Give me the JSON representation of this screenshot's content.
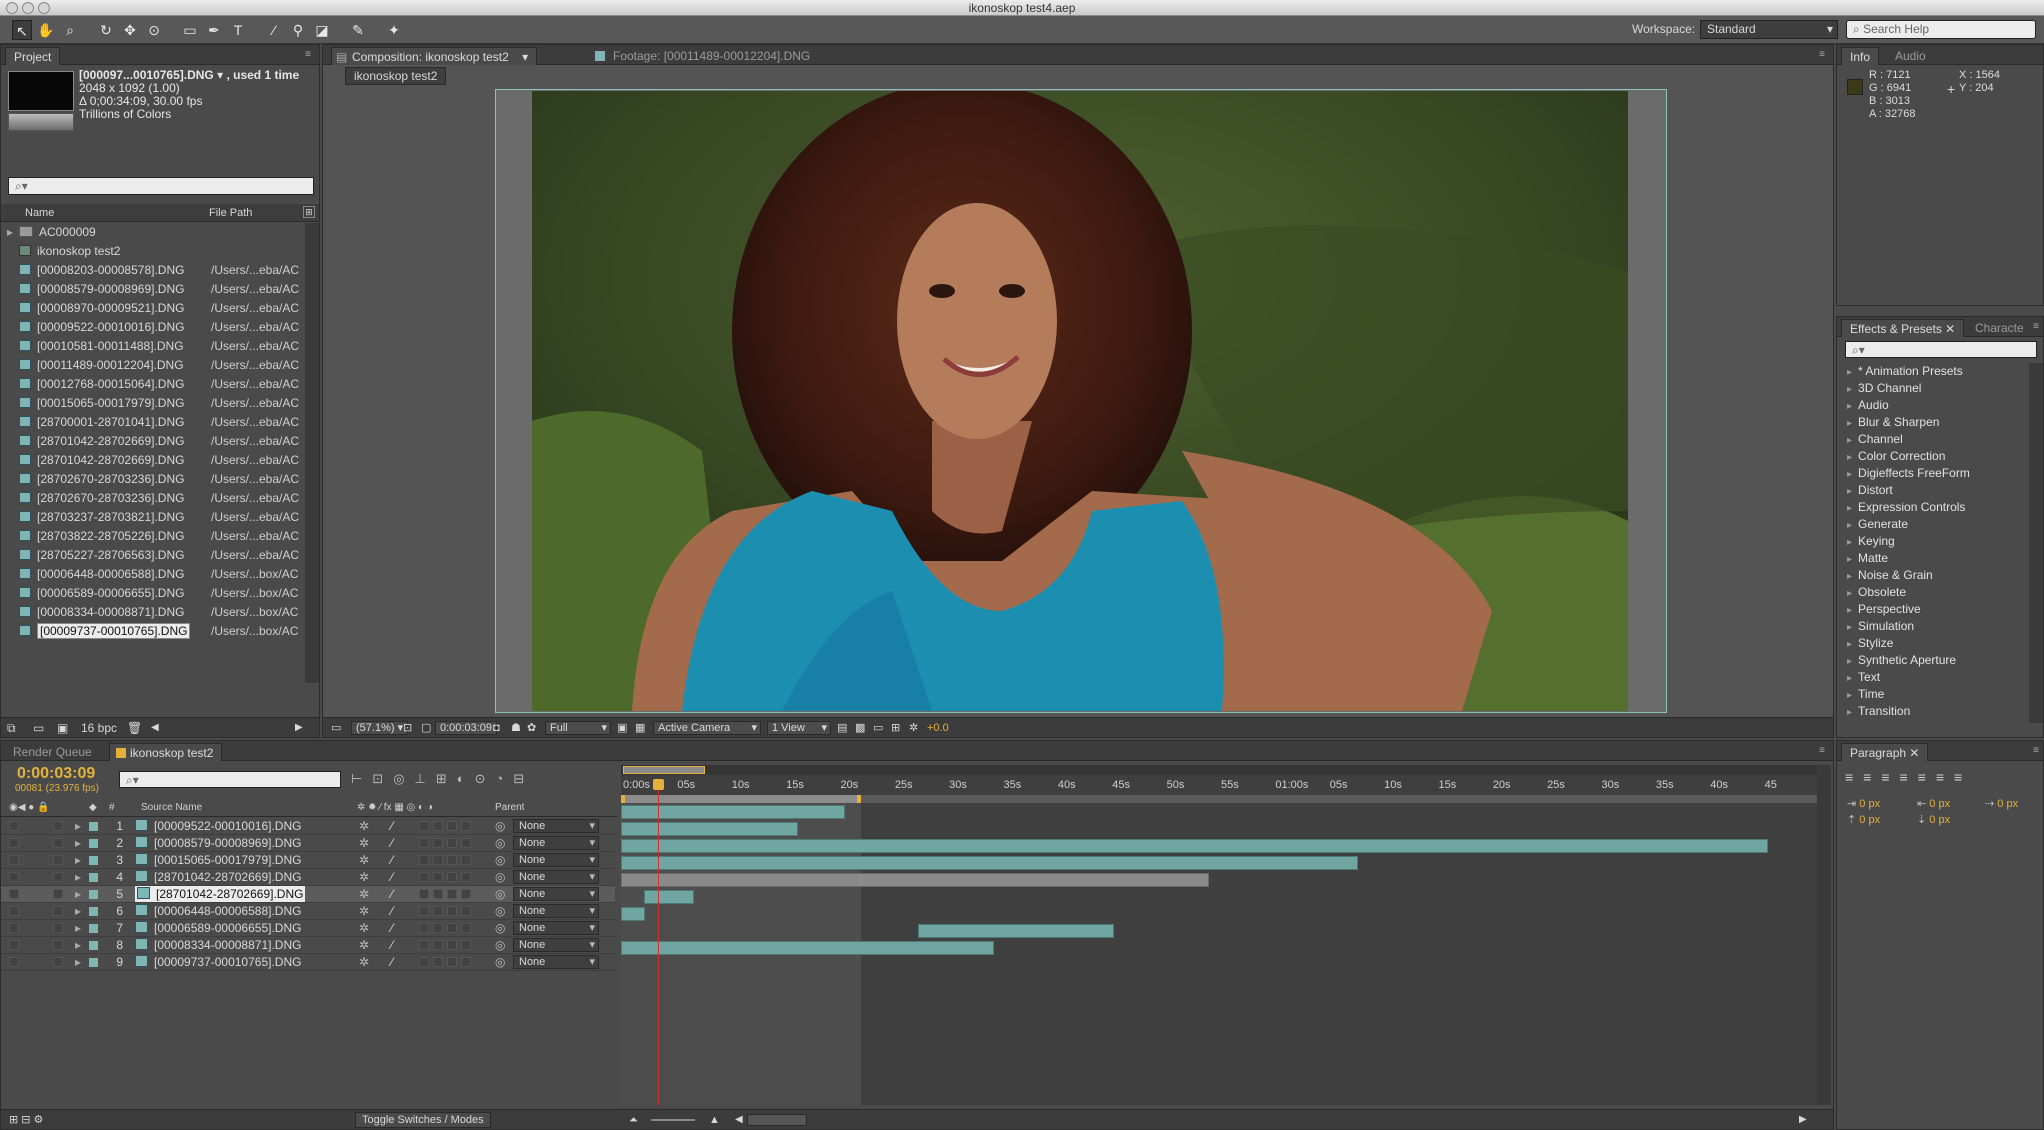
{
  "window": {
    "title": "ikonoskop test4.aep"
  },
  "toolbar": {
    "workspace_label": "Workspace:",
    "workspace_value": "Standard",
    "search_placeholder": "Search Help",
    "tools": [
      "selection-tool-icon",
      "hand-tool-icon",
      "zoom-tool-icon",
      "rotation-tool-icon",
      "camera-orbit-icon",
      "pan-behind-icon",
      "rectangle-tool-icon",
      "pen-tool-icon",
      "text-tool-icon",
      "brush-tool-icon",
      "clone-stamp-icon",
      "eraser-icon",
      "roto-brush-icon",
      "puppet-pin-icon"
    ]
  },
  "project": {
    "tab": "Project",
    "selected_name": "[000097...0010765].DNG ▾ , used 1 time",
    "selected_size": "2048 x 1092 (1.00)",
    "selected_duration": "Δ 0;00:34:09, 30.00 fps",
    "selected_colors": "Trillions of Colors",
    "col_name": "Name",
    "col_path": "File Path",
    "bpc": "16 bpc",
    "items": [
      {
        "name": "AC000009",
        "path": "",
        "kind": "folder"
      },
      {
        "name": "ikonoskop test2",
        "path": "",
        "kind": "comp"
      },
      {
        "name": "[00008203-00008578].DNG",
        "path": "/Users/...eba/AC",
        "kind": "file"
      },
      {
        "name": "[00008579-00008969].DNG",
        "path": "/Users/...eba/AC",
        "kind": "file"
      },
      {
        "name": "[00008970-00009521].DNG",
        "path": "/Users/...eba/AC",
        "kind": "file"
      },
      {
        "name": "[00009522-00010016].DNG",
        "path": "/Users/...eba/AC",
        "kind": "file"
      },
      {
        "name": "[00010581-00011488].DNG",
        "path": "/Users/...eba/AC",
        "kind": "file"
      },
      {
        "name": "[00011489-00012204].DNG",
        "path": "/Users/...eba/AC",
        "kind": "file"
      },
      {
        "name": "[00012768-00015064].DNG",
        "path": "/Users/...eba/AC",
        "kind": "file"
      },
      {
        "name": "[00015065-00017979].DNG",
        "path": "/Users/...eba/AC",
        "kind": "file"
      },
      {
        "name": "[28700001-28701041].DNG",
        "path": "/Users/...eba/AC",
        "kind": "file"
      },
      {
        "name": "[28701042-28702669].DNG",
        "path": "/Users/...eba/AC",
        "kind": "file"
      },
      {
        "name": "[28701042-28702669].DNG",
        "path": "/Users/...eba/AC",
        "kind": "file"
      },
      {
        "name": "[28702670-28703236].DNG",
        "path": "/Users/...eba/AC",
        "kind": "file"
      },
      {
        "name": "[28702670-28703236].DNG",
        "path": "/Users/...eba/AC",
        "kind": "file"
      },
      {
        "name": "[28703237-28703821].DNG",
        "path": "/Users/...eba/AC",
        "kind": "file"
      },
      {
        "name": "[28703822-28705226].DNG",
        "path": "/Users/...eba/AC",
        "kind": "file"
      },
      {
        "name": "[28705227-28706563].DNG",
        "path": "/Users/...eba/AC",
        "kind": "file"
      },
      {
        "name": "[00006448-00006588].DNG",
        "path": "/Users/...box/AC",
        "kind": "file"
      },
      {
        "name": "[00006589-00006655].DNG",
        "path": "/Users/...box/AC",
        "kind": "file"
      },
      {
        "name": "[00008334-00008871].DNG",
        "path": "/Users/...box/AC",
        "kind": "file"
      },
      {
        "name": "[00009737-00010765].DNG",
        "path": "/Users/...box/AC",
        "kind": "file",
        "selected": true
      }
    ]
  },
  "viewer": {
    "comp_tab": "Composition: ikonoskop test2",
    "footage_tab": "Footage: [00011489-00012204].DNG",
    "breadcrumb": "ikonoskop test2",
    "zoom": "(57.1%)",
    "timecode": "0:00:03:09",
    "resolution": "Full",
    "camera": "Active Camera",
    "view": "1 View",
    "exposure": "+0.0"
  },
  "info": {
    "tab": "Info",
    "audio_tab": "Audio",
    "r": "R : 7121",
    "g": "G : 6941",
    "b": "B : 3013",
    "a": "A : 32768",
    "x": "X : 1564",
    "y": "Y : 204",
    "swatch": "#3a3a18"
  },
  "effects": {
    "tab": "Effects & Presets",
    "char_tab": "Characte",
    "items": [
      "* Animation Presets",
      "3D Channel",
      "Audio",
      "Blur & Sharpen",
      "Channel",
      "Color Correction",
      "Digieffects FreeForm",
      "Distort",
      "Expression Controls",
      "Generate",
      "Keying",
      "Matte",
      "Noise & Grain",
      "Obsolete",
      "Perspective",
      "Simulation",
      "Stylize",
      "Synthetic Aperture",
      "Text",
      "Time",
      "Transition"
    ]
  },
  "paragraph": {
    "tab": "Paragraph",
    "values": [
      "0 px",
      "0 px",
      "0 px",
      "0 px",
      "0 px"
    ]
  },
  "timeline": {
    "render_tab": "Render Queue",
    "comp_tab": "ikonoskop test2",
    "timecode": "0:00:03:09",
    "frames": "00081 (23.976 fps)",
    "col_source": "Source Name",
    "col_parent": "Parent",
    "col_hash": "#",
    "toggle": "Toggle Switches / Modes",
    "ticks": [
      "0:00s",
      "05s",
      "10s",
      "15s",
      "20s",
      "25s",
      "30s",
      "35s",
      "40s",
      "45s",
      "50s",
      "55s",
      "01:00s",
      "05s",
      "10s",
      "15s",
      "20s",
      "25s",
      "30s",
      "35s",
      "40s",
      "45"
    ],
    "playhead_s": 3.4,
    "layers": [
      {
        "num": "1",
        "name": "[00009522-00010016].DNG",
        "parent": "None",
        "start_s": 0,
        "end_s": 20.6
      },
      {
        "num": "2",
        "name": "[00008579-00008969].DNG",
        "parent": "None",
        "start_s": 0,
        "end_s": 16.3
      },
      {
        "num": "3",
        "name": "[00015065-00017979].DNG",
        "parent": "None",
        "start_s": 0,
        "end_s": 105.5
      },
      {
        "num": "4",
        "name": "[28701042-28702669].DNG",
        "parent": "None",
        "start_s": 0,
        "end_s": 67.8
      },
      {
        "num": "5",
        "name": "[28701042-28702669].DNG",
        "parent": "None",
        "start_s": 0,
        "end_s": 54.1,
        "selected": true
      },
      {
        "num": "6",
        "name": "[00006448-00006588].DNG",
        "parent": "None",
        "start_s": 2.1,
        "end_s": 6.7
      },
      {
        "num": "7",
        "name": "[00006589-00006655].DNG",
        "parent": "None",
        "start_s": 0,
        "end_s": 2.2
      },
      {
        "num": "8",
        "name": "[00008334-00008871].DNG",
        "parent": "None",
        "start_s": 27.3,
        "end_s": 45.3
      },
      {
        "num": "9",
        "name": "[00009737-00010765].DNG",
        "parent": "None",
        "start_s": 0,
        "end_s": 34.3
      }
    ]
  }
}
